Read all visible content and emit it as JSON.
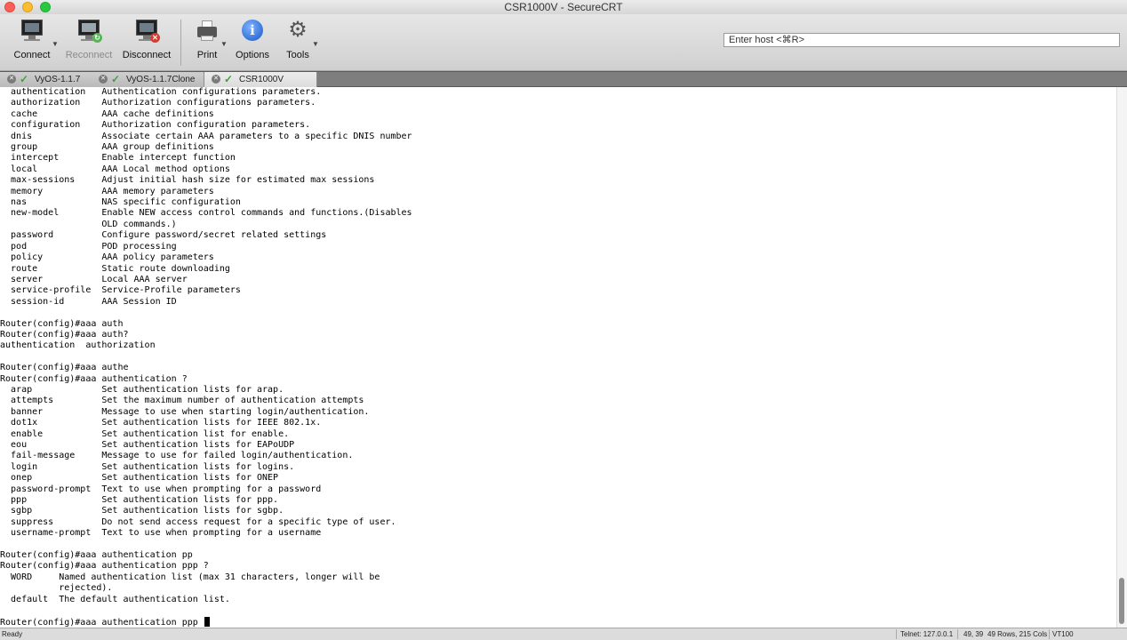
{
  "window": {
    "title": "CSR1000V - SecureCRT"
  },
  "toolbar": {
    "connect_label": "Connect",
    "reconnect_label": "Reconnect",
    "disconnect_label": "Disconnect",
    "print_label": "Print",
    "options_label": "Options",
    "tools_label": "Tools",
    "host_placeholder": "Enter host <⌘R>"
  },
  "tabs": [
    {
      "label": "VyOS-1.1.7",
      "active": false
    },
    {
      "label": "VyOS-1.1.7Clone",
      "active": false
    },
    {
      "label": "CSR1000V",
      "active": true
    }
  ],
  "terminal": {
    "lines": [
      "  authentication   Authentication configurations parameters.",
      "  authorization    Authorization configurations parameters.",
      "  cache            AAA cache definitions",
      "  configuration    Authorization configuration parameters.",
      "  dnis             Associate certain AAA parameters to a specific DNIS number",
      "  group            AAA group definitions",
      "  intercept        Enable intercept function",
      "  local            AAA Local method options",
      "  max-sessions     Adjust initial hash size for estimated max sessions",
      "  memory           AAA memory parameters",
      "  nas              NAS specific configuration",
      "  new-model        Enable NEW access control commands and functions.(Disables",
      "                   OLD commands.)",
      "  password         Configure password/secret related settings",
      "  pod              POD processing",
      "  policy           AAA policy parameters",
      "  route            Static route downloading",
      "  server           Local AAA server",
      "  service-profile  Service-Profile parameters",
      "  session-id       AAA Session ID",
      "",
      "Router(config)#aaa auth",
      "Router(config)#aaa auth?",
      "authentication  authorization",
      "",
      "Router(config)#aaa authe",
      "Router(config)#aaa authentication ?",
      "  arap             Set authentication lists for arap.",
      "  attempts         Set the maximum number of authentication attempts",
      "  banner           Message to use when starting login/authentication.",
      "  dot1x            Set authentication lists for IEEE 802.1x.",
      "  enable           Set authentication list for enable.",
      "  eou              Set authentication lists for EAPoUDP",
      "  fail-message     Message to use for failed login/authentication.",
      "  login            Set authentication lists for logins.",
      "  onep             Set authentication lists for ONEP",
      "  password-prompt  Text to use when prompting for a password",
      "  ppp              Set authentication lists for ppp.",
      "  sgbp             Set authentication lists for sgbp.",
      "  suppress         Do not send access request for a specific type of user.",
      "  username-prompt  Text to use when prompting for a username",
      "",
      "Router(config)#aaa authentication pp",
      "Router(config)#aaa authentication ppp ?",
      "  WORD     Named authentication list (max 31 characters, longer will be",
      "           rejected).",
      "  default  The default authentication list.",
      ""
    ],
    "prompt_line": "Router(config)#aaa authentication ppp "
  },
  "status": {
    "state": "Ready",
    "connection": "Telnet: 127.0.0.1",
    "position": "49, 39",
    "size": "49 Rows, 215 Cols",
    "emulation": "VT100"
  }
}
